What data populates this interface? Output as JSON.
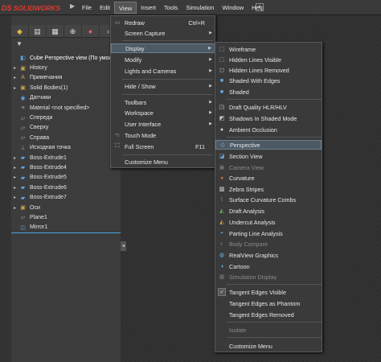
{
  "app": {
    "logo_text": "SOLIDWORKS",
    "logo_mark": "DS"
  },
  "menubar": {
    "items": [
      "File",
      "Edit",
      "View",
      "Insert",
      "Tools",
      "Simulation",
      "Window",
      "Help"
    ],
    "active": "View"
  },
  "tree": {
    "root": "Cube Perspective view  (По умолча",
    "items": [
      "History",
      "Примечания",
      "Solid Bodies(1)",
      "Датчики",
      "Material <not specified>",
      "Спереди",
      "Сверху",
      "Справа",
      "Исходная точка",
      "Boss-Extrude1",
      "Boss-Extrude4",
      "Boss-Extrude5",
      "Boss-Extrude6",
      "Boss-Extrude7",
      "Оси",
      "Plane1",
      "Mirror1"
    ]
  },
  "view_menu": {
    "redraw": "Redraw",
    "redraw_shortcut": "Ctrl+R",
    "screen_capture": "Screen Capture",
    "display": "Display",
    "modify": "Modify",
    "lights_cameras": "Lights and Cameras",
    "hide_show": "Hide / Show",
    "toolbars": "Toolbars",
    "workspace": "Workspace",
    "user_interface": "User Interface",
    "touch_mode": "Touch Mode",
    "full_screen": "Full Screen",
    "full_screen_shortcut": "F11",
    "customize": "Customize Menu"
  },
  "display_menu": {
    "wireframe": "Wireframe",
    "hlv": "Hidden Lines Visible",
    "hlr": "Hidden Lines Removed",
    "shaded_edges": "Shaded With Edges",
    "shaded": "Shaded",
    "draft_hlr": "Draft Quality HLR/HLV",
    "shadows": "Shadows In Shaded Mode",
    "ao": "Ambient Occlusion",
    "perspective": "Perspective",
    "section": "Section View",
    "camera": "Camera View",
    "curvature": "Curvature",
    "zebra": "Zebra Stripes",
    "combs": "Surface Curvature Combs",
    "draft": "Draft Analysis",
    "undercut": "Undercut Analysis",
    "parting": "Parting Line Analysis",
    "body_compare": "Body Compare",
    "realview": "RealView Graphics",
    "cartoon": "Cartoon",
    "sim_display": "Simulation Display",
    "tev": "Tangent Edges Visible",
    "tep": "Tangent Edges as Phantom",
    "ter": "Tangent Edges Removed",
    "isolate": "Isolate",
    "customize": "Customize Menu"
  }
}
